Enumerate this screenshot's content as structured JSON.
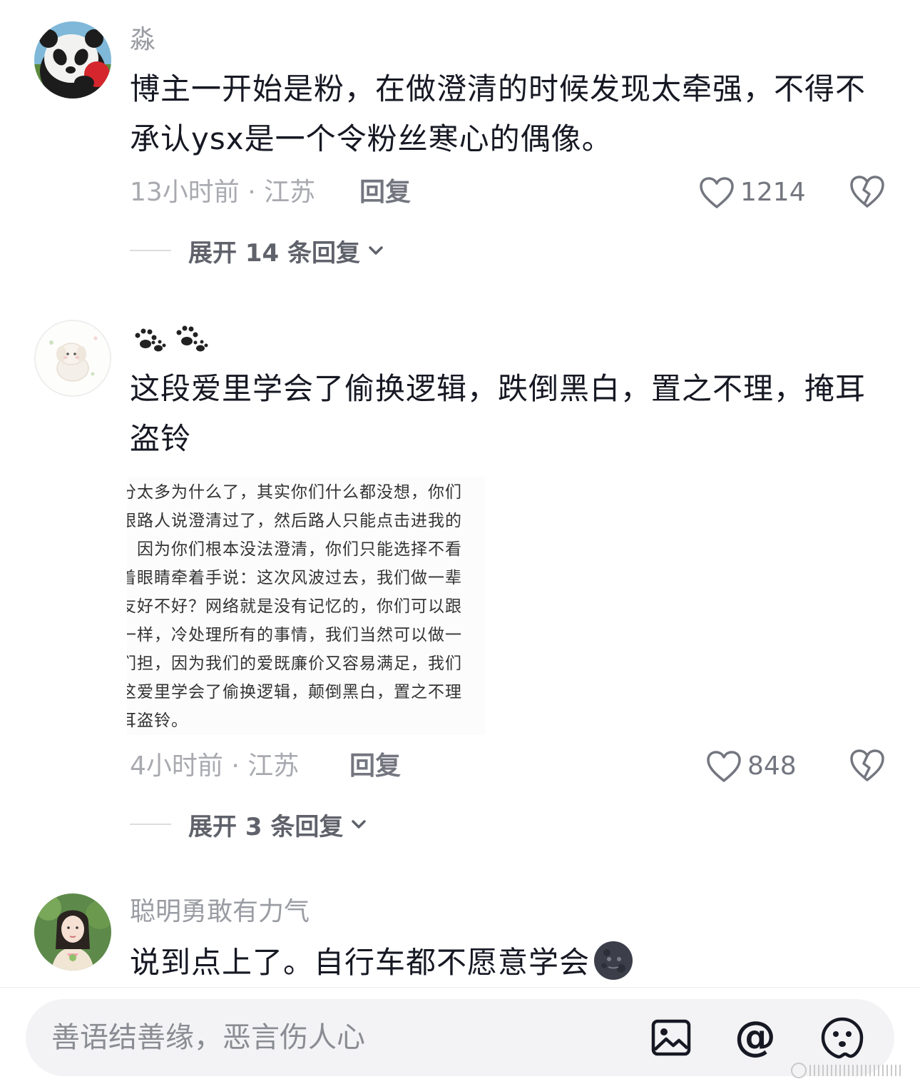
{
  "comments": [
    {
      "username": "淼",
      "text": "博主一开始是粉，在做澄清的时候发现太牵强，不得不承认ysx是一个令粉丝寒心的偶像。",
      "time_location": "13小时前 · 江苏",
      "reply_label": "回复",
      "like_count": "1214",
      "expand_label": "展开 14 条回复"
    },
    {
      "username": "🐾🐾",
      "text": "这段爱里学会了偷换逻辑，跌倒黑白，置之不理，掩耳盗铃",
      "attachment_lines": [
        "分太多为什么了，其实你们什么都没想，你们",
        "跟路人说澄清过了，然后路人只能点击进我的",
        "，因为你们根本没法澄清，你们只能选择不看",
        "着眼睛牵着手说：这次风波过去，我们做一辈",
        "友好不好？网络就是没有记忆的，你们可以跟",
        "一样，冷处理所有的事情，我们当然可以做一",
        "们担，因为我们的爱既廉价又容易满足，我们",
        "这爱里学会了偷换逻辑，颠倒黑白，置之不理",
        "耳盗铃。"
      ],
      "time_location": "4小时前 · 江苏",
      "reply_label": "回复",
      "like_count": "848",
      "expand_label": "展开 3 条回复"
    },
    {
      "username": "聪明勇敢有力气",
      "text": "说到点上了。自行车都不愿意学会"
    }
  ],
  "input": {
    "placeholder": "善语结善缘，恶言伤人心"
  },
  "icons": {
    "like": "heart-outline-icon",
    "dislike": "broken-heart-icon",
    "chevron": "chevron-down-icon",
    "image": "image-icon",
    "mention": "at-icon",
    "emoji": "emoji-icon"
  },
  "colors": {
    "text_primary": "#161823",
    "text_secondary": "#9a9ca3",
    "input_bg": "#f3f3f5"
  }
}
